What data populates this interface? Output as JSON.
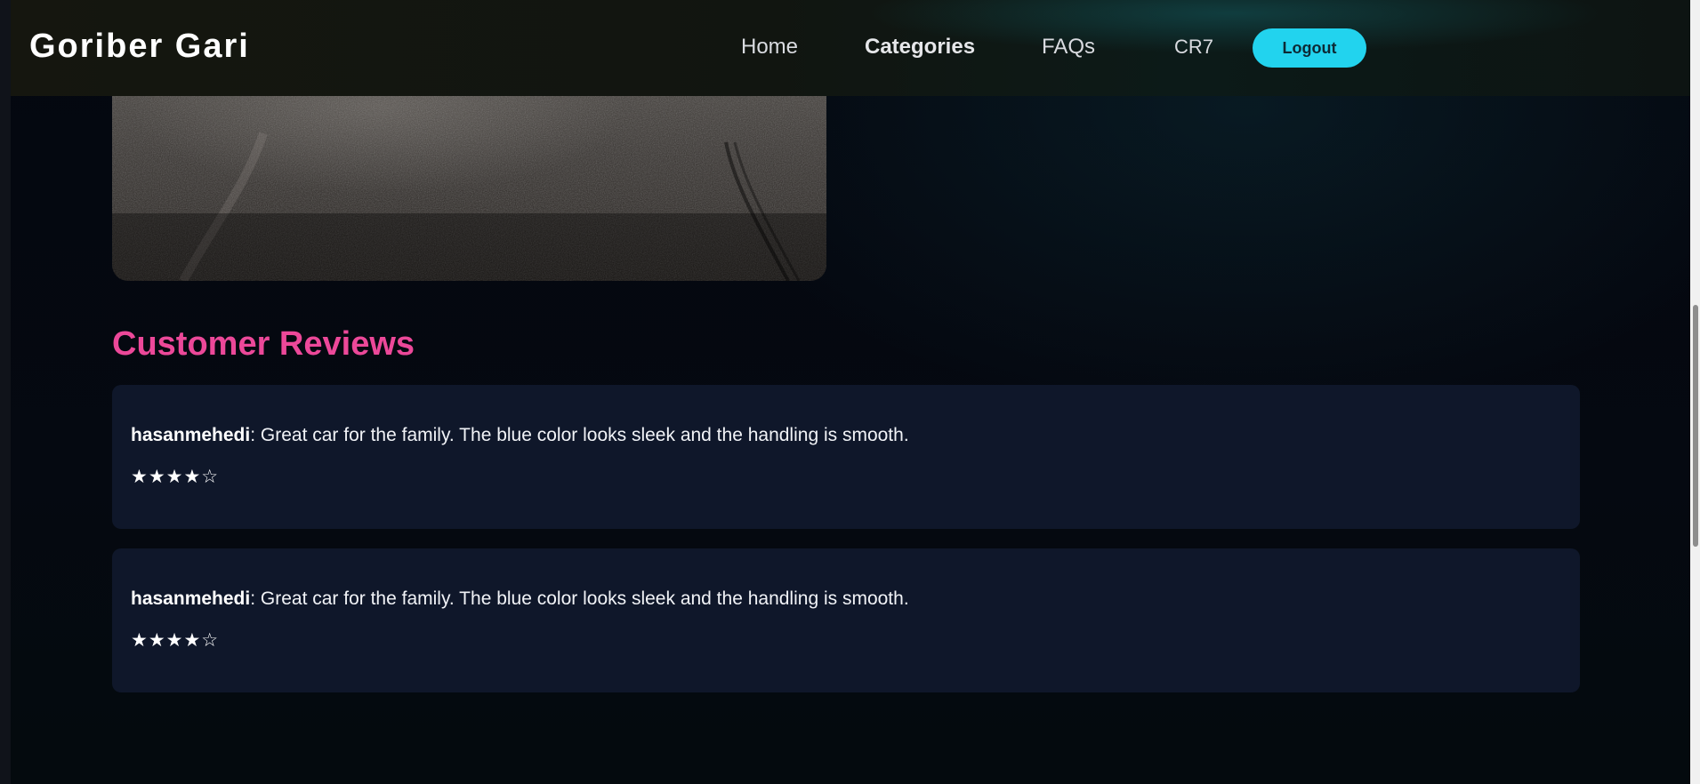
{
  "navbar": {
    "brand": "Goriber Gari",
    "links": [
      {
        "label": "Home",
        "active": false
      },
      {
        "label": "Categories",
        "active": true
      },
      {
        "label": "FAQs",
        "active": false
      }
    ],
    "user_name": "CR7",
    "logout_label": "Logout",
    "accent_color": "#22d3ee"
  },
  "reviews": {
    "title": "Customer Reviews",
    "title_color": "#ec4899",
    "items": [
      {
        "author": "hasanmehedi",
        "text": ": Great car for the family. The blue color looks sleek and the handling is smooth.",
        "stars": "★★★★☆",
        "rating": 4,
        "max_rating": 5
      },
      {
        "author": "hasanmehedi",
        "text": ": Great car for the family. The blue color looks sleek and the handling is smooth.",
        "stars": "★★★★☆",
        "rating": 4,
        "max_rating": 5
      }
    ]
  },
  "colors": {
    "background": "#05070d",
    "card_background": "#0f172a"
  }
}
